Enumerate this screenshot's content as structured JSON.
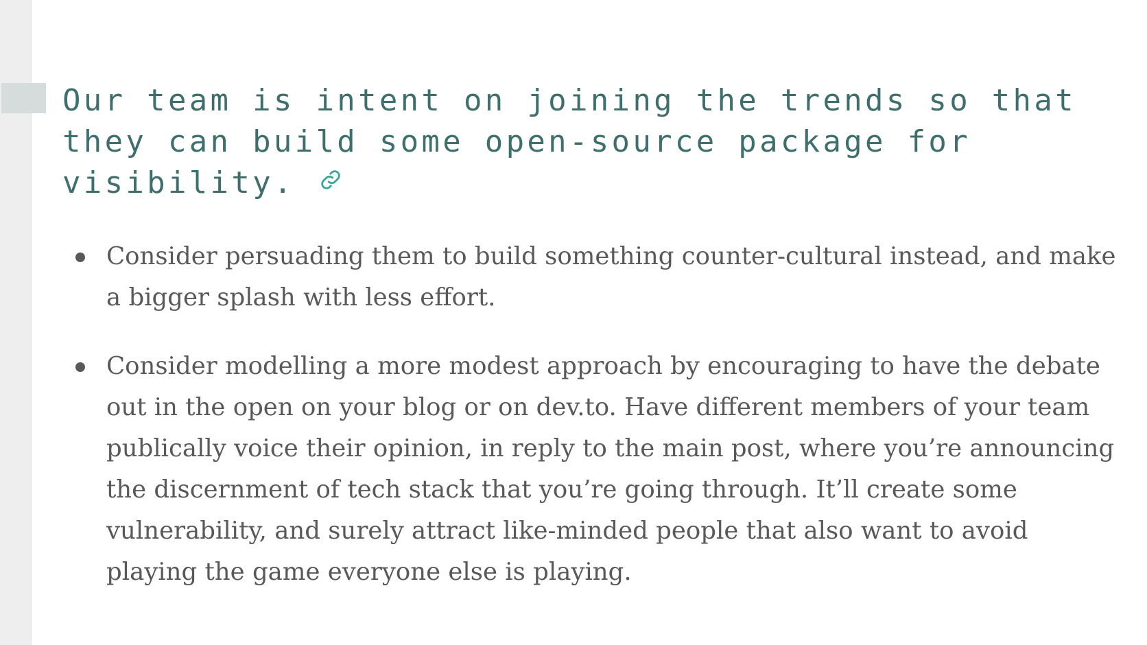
{
  "heading": {
    "text": "Our team is intent on joining the trends so that they can build some open-source package for visibility.",
    "anchor_icon": "link-icon"
  },
  "list": {
    "items": [
      {
        "text": "Consider persuading them to build something counter-cultural instead, and make a bigger splash with less effort."
      },
      {
        "text": "Consider modelling a more modest approach by encouraging to have the debate out in the open on your blog or on dev.to. Have different members of your team publically voice their opinion, in reply to the main post, where you’re announcing the discernment of tech stack that you’re going through. It’ll create some vulnerability, and surely attract like-minded people that also want to avoid playing the game everyone else is playing."
      }
    ]
  },
  "colors": {
    "heading": "#3f6f6c",
    "link_icon": "#3aa89b",
    "body_text": "#595959",
    "left_rail": "#eeeeee",
    "heading_marker": "#d6dcdb"
  }
}
